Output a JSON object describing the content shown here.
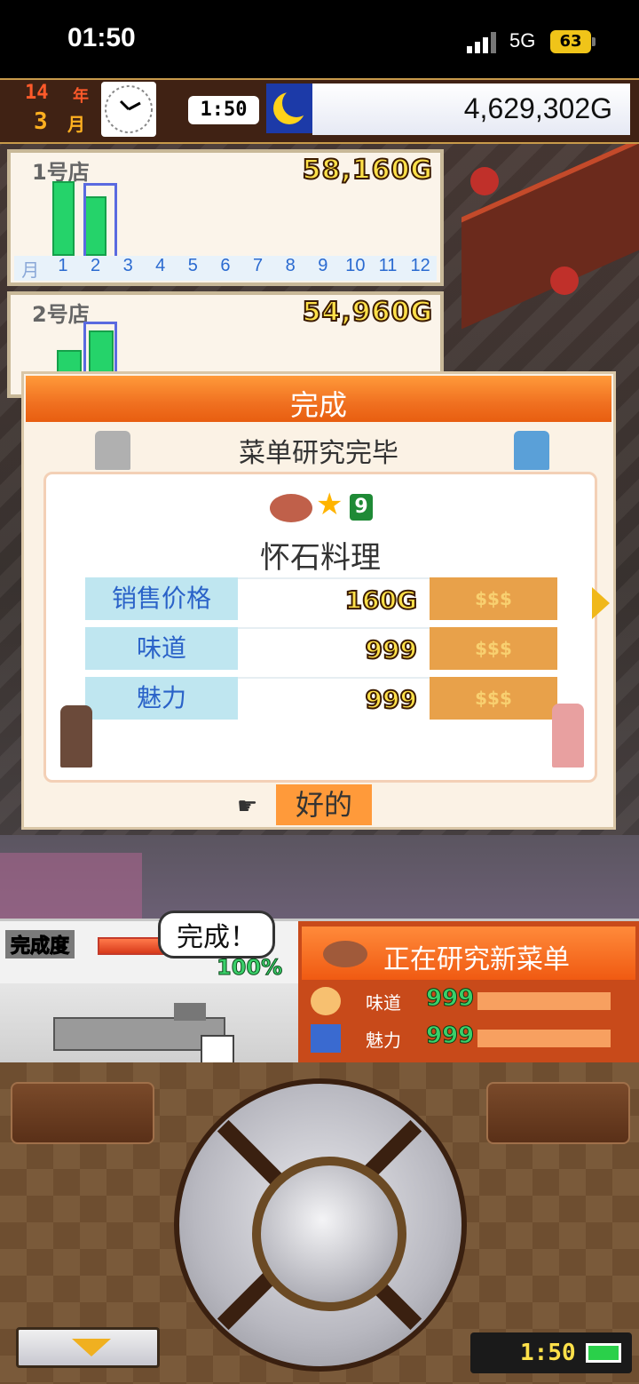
{
  "status_bar": {
    "time": "01:50",
    "network": "5G",
    "battery": "63"
  },
  "hud": {
    "year_number": "14",
    "year_unit": "年",
    "month_number": "3",
    "month_unit": "月",
    "game_time": "1:50",
    "money": "4,629,302G"
  },
  "stores": [
    {
      "name": "1号店",
      "revenue": "58,160G",
      "months": [
        "月",
        "1",
        "2",
        "3",
        "4",
        "5",
        "6",
        "7",
        "8",
        "9",
        "10",
        "11",
        "12"
      ]
    },
    {
      "name": "2号店",
      "revenue": "54,960G"
    }
  ],
  "chart_data": {
    "type": "bar",
    "title": "1号店",
    "categories": [
      "1",
      "2",
      "3",
      "4",
      "5",
      "6",
      "7",
      "8",
      "9",
      "10",
      "11",
      "12"
    ],
    "values": [
      1,
      0.8,
      0,
      0,
      0,
      0,
      0,
      0,
      0,
      0,
      0,
      0
    ],
    "selected_month": "2"
  },
  "dialog": {
    "title": "完成",
    "subtitle": "菜单研究完毕",
    "level": "9",
    "dish_name": "怀石料理",
    "stats": [
      {
        "label": "销售价格",
        "value": "160G",
        "rank": "$$$"
      },
      {
        "label": "味道",
        "value": "999",
        "rank": "$$$"
      },
      {
        "label": "魅力",
        "value": "999",
        "rank": "$$$"
      }
    ],
    "ok_label": "好的"
  },
  "progress": {
    "label": "完成度",
    "speech": "完成！",
    "percent": "100%",
    "fraction": 1.0
  },
  "research": {
    "title": "正在研究新菜单",
    "rows": [
      {
        "label": "味道",
        "value": "999",
        "icon": "taste-icon"
      },
      {
        "label": "魅力",
        "value": "999",
        "icon": "charm-icon"
      }
    ]
  },
  "footer": {
    "clock": "1:50"
  },
  "colors": {
    "accent_orange": "#f07020",
    "bar_green": "#25d36a",
    "money_yellow": "#ffe14a"
  }
}
